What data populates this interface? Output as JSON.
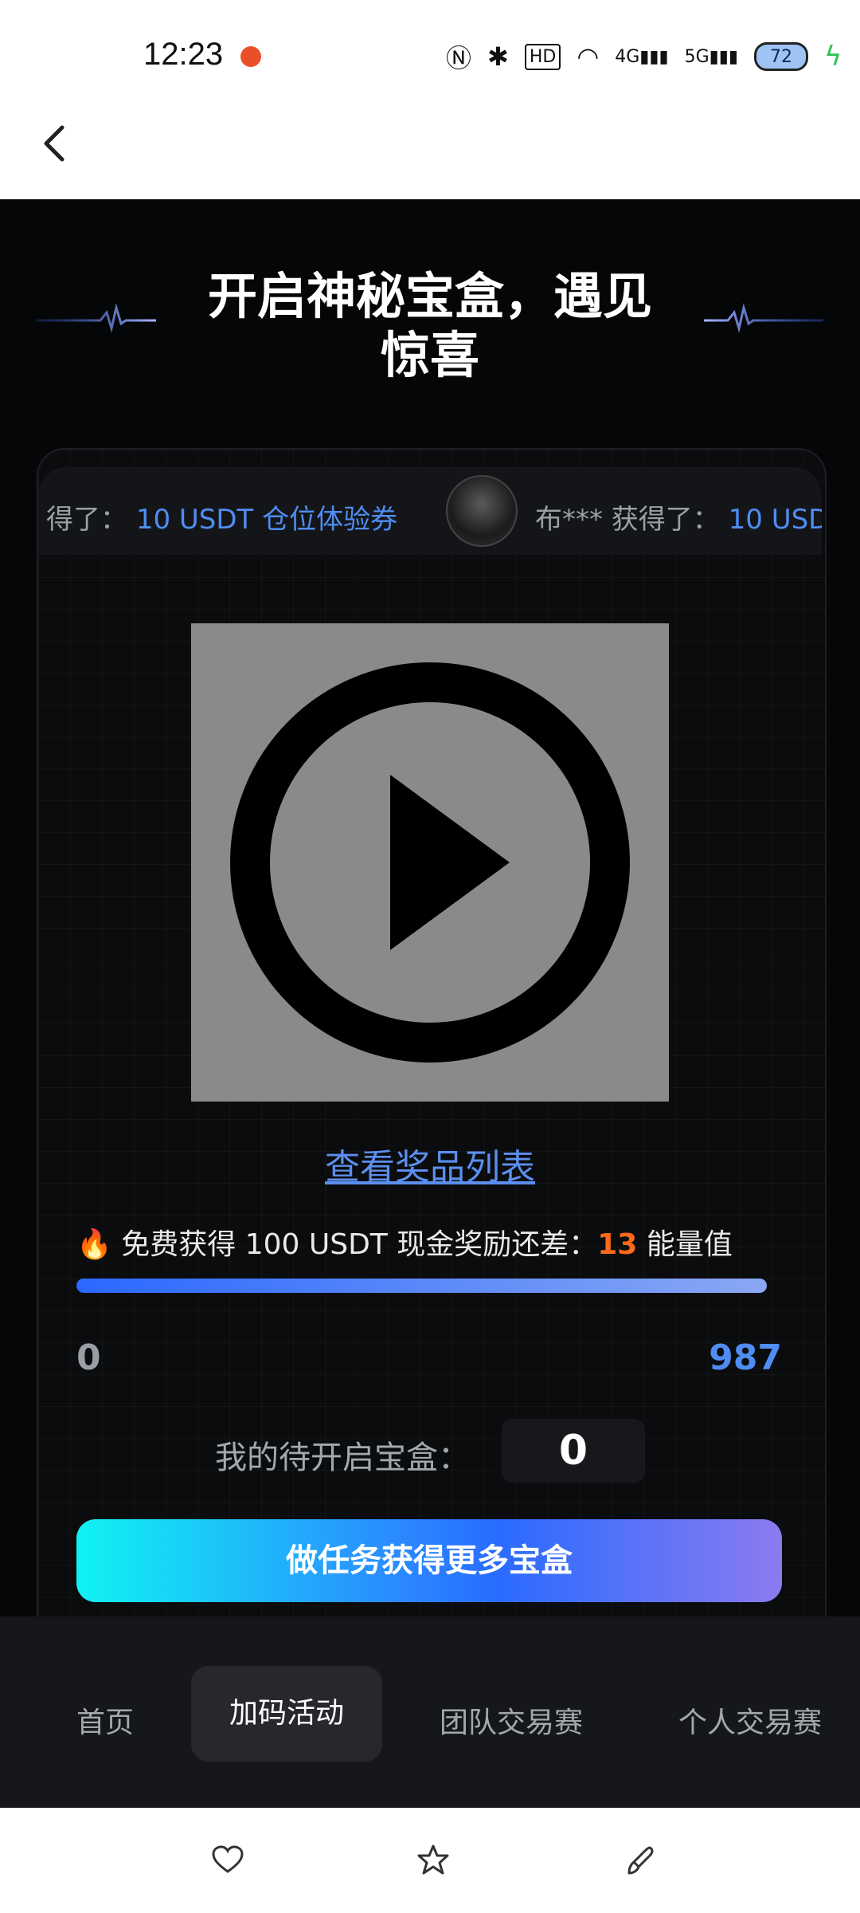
{
  "status_bar": {
    "time": "12:23",
    "hd": "HD",
    "net1": "4G",
    "net2": "5G",
    "battery": "72"
  },
  "header": {
    "back_icon": "chevron-left-icon"
  },
  "hero": {
    "title": "开启神秘宝盒，遇见惊喜"
  },
  "ticker": {
    "item1_prefix": "得了：",
    "item1_prize": "10 USDT 仓位体验券",
    "item2_user": "布*** 获得了：",
    "item2_prize": "10 USD"
  },
  "prize_link": "查看奖品列表",
  "reward": {
    "text_prefix": "免费获得 100 USDT 现金奖励还差：",
    "remaining": "13",
    "unit": "能量值",
    "progress_min": "0",
    "progress_max": "987",
    "progress_fraction": 0.987
  },
  "pending": {
    "label": "我的待开启宝盒：",
    "count": "0"
  },
  "task_button": "做任务获得更多宝盒",
  "tabs": [
    {
      "label": "首页",
      "active": false
    },
    {
      "label": "加码活动",
      "active": true
    },
    {
      "label": "团队交易赛",
      "active": false
    },
    {
      "label": "个人交易赛",
      "active": false
    }
  ],
  "colors": {
    "accent_blue": "#4f8df2",
    "orange": "#ff6a1a",
    "background_dark": "#050607"
  }
}
